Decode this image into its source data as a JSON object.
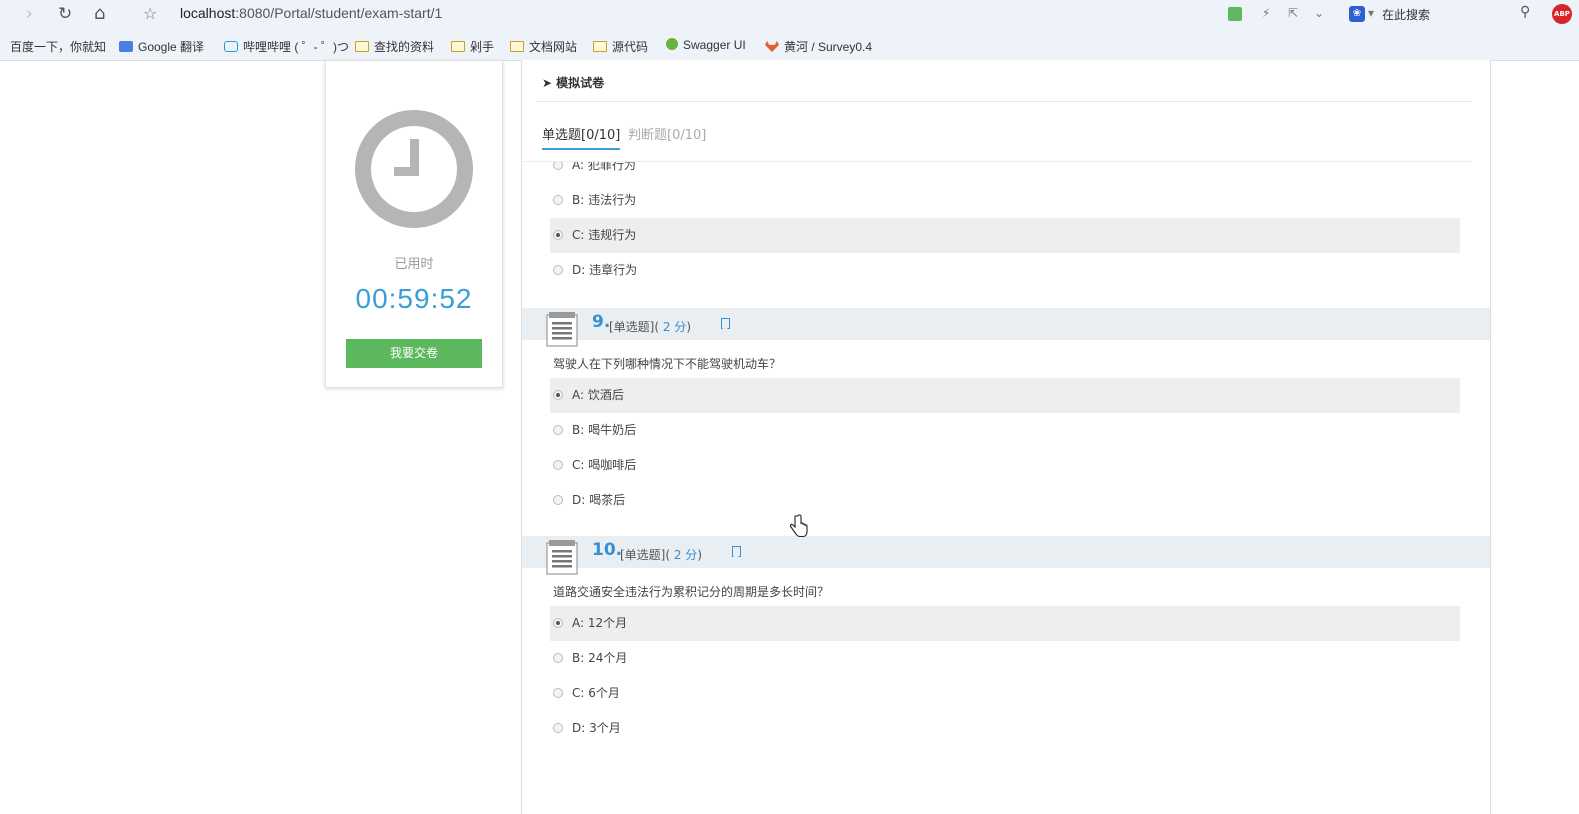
{
  "browser": {
    "url_host": "localhost",
    "url_path": ":8080/Portal/student/exam-start/1",
    "search_placeholder": "在此搜索",
    "bookmarks": [
      "百度一下，你就知",
      "Google 翻译",
      "哔哩哔哩 ( ゜- ゜)つ",
      "查找的资料",
      "剁手",
      "文档网站",
      "源代码",
      "Swagger UI",
      "黄河 / Survey0.4"
    ]
  },
  "timer_card": {
    "used_label": "已用时",
    "elapsed": "00:59:52",
    "submit_label": "我要交卷"
  },
  "panel": {
    "title": "模拟试卷",
    "tabs": [
      {
        "label": "单选题[0/10]",
        "active": true
      },
      {
        "label": "判断题[0/10]",
        "active": false
      }
    ]
  },
  "questions": [
    {
      "number": "",
      "options": [
        {
          "text": "A: 犯罪行为",
          "selected": false
        },
        {
          "text": "B: 违法行为",
          "selected": false
        },
        {
          "text": "C: 违规行为",
          "selected": true
        },
        {
          "text": "D: 违章行为",
          "selected": false
        }
      ]
    },
    {
      "number": "9.",
      "type": "[单选题](",
      "points": " 2 分",
      "close": ")",
      "text": "驾驶人在下列哪种情况下不能驾驶机动车？",
      "options": [
        {
          "text": "A: 饮酒后",
          "selected": true
        },
        {
          "text": "B: 喝牛奶后",
          "selected": false
        },
        {
          "text": "C: 喝咖啡后",
          "selected": false
        },
        {
          "text": "D: 喝茶后",
          "selected": false
        }
      ]
    },
    {
      "number": "10.",
      "type": "[单选题](",
      "points": " 2 分",
      "close": ")",
      "text": "道路交通安全违法行为累积记分的周期是多长时间？",
      "options": [
        {
          "text": "A: 12个月",
          "selected": true
        },
        {
          "text": "B: 24个月",
          "selected": false
        },
        {
          "text": "C: 6个月",
          "selected": false
        },
        {
          "text": "D: 3个月",
          "selected": false
        }
      ]
    }
  ],
  "colors": {
    "accent": "#3a9fd8",
    "submit": "#5cb85c",
    "question_header": "#e8eef2",
    "selected_row": "#eeeeee"
  }
}
